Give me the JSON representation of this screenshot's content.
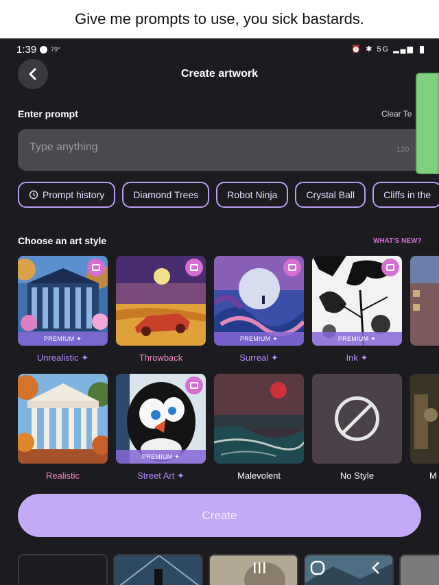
{
  "caption": "Give me prompts to use, you sick bastards.",
  "status_bar": {
    "time": "1:39",
    "temperature": "79°",
    "network": "5G"
  },
  "header": {
    "title": "Create artwork"
  },
  "prompt": {
    "label": "Enter prompt",
    "clear_label": "Clear Te",
    "placeholder": "Type anything",
    "char_limit": "120"
  },
  "chips": [
    {
      "label": "Prompt history",
      "icon": "history-icon"
    },
    {
      "label": "Diamond Trees"
    },
    {
      "label": "Robot Ninja"
    },
    {
      "label": "Crystal Ball"
    },
    {
      "label": "Cliffs in the"
    }
  ],
  "styles": {
    "heading": "Choose an art style",
    "whats_new": "WHAT'S NEW?",
    "premium_text": "PREMIUM",
    "row1": [
      {
        "label": "Unrealistic",
        "premium": true
      },
      {
        "label": "Throwback",
        "premium": false
      },
      {
        "label": "Surreal",
        "premium": true
      },
      {
        "label": "Ink",
        "premium": true
      }
    ],
    "row2": [
      {
        "label": "Realistic",
        "premium": false
      },
      {
        "label": "Street Art",
        "premium": true
      },
      {
        "label": "Malevolent",
        "premium": false
      },
      {
        "label": "No Style",
        "premium": false
      },
      {
        "label": "M"
      }
    ]
  },
  "create_button": "Create",
  "colors": {
    "accent": "#c3a9f6",
    "chip_border": "#b89ef5",
    "premium_badge": "#d56fd3",
    "background": "#1c1b1f"
  }
}
